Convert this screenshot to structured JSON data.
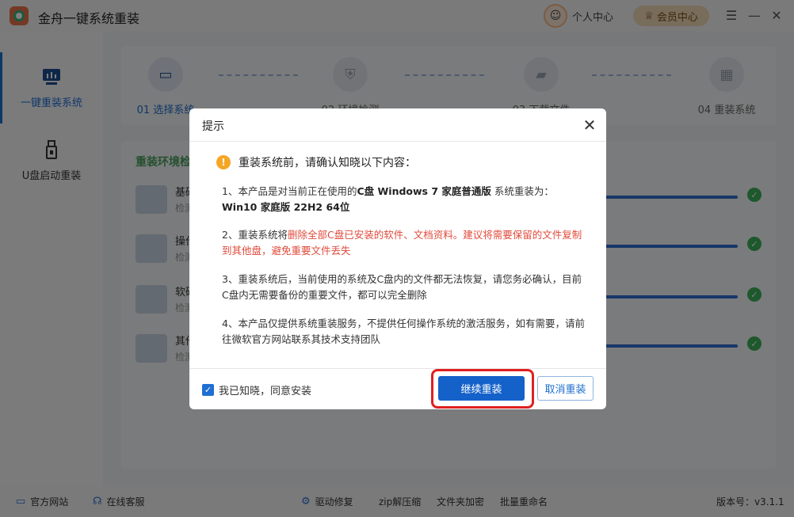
{
  "app": {
    "title": "金舟一键系统重装"
  },
  "header": {
    "user_center": "个人中心",
    "vip_center": "会员中心",
    "menu_icon": "menu-icon",
    "minimize_icon": "minimize-icon",
    "close_icon": "close-icon"
  },
  "sidebar": {
    "items": [
      {
        "label": "一键重装系统",
        "icon": "monitor-chart-icon",
        "active": true
      },
      {
        "label": "U盘启动重装",
        "icon": "usb-icon",
        "active": false
      }
    ]
  },
  "steps": [
    {
      "label": "01 选择系统",
      "icon": "monitor-icon"
    },
    {
      "label": "02 环境检测",
      "icon": "shield-icon"
    },
    {
      "label": "03 下载文件",
      "icon": "folder-icon"
    },
    {
      "label": "04 重装系统",
      "icon": "grid-icon"
    }
  ],
  "env": {
    "title": "重装环境检",
    "rows": [
      {
        "name": "基础",
        "sub": "检测"
      },
      {
        "name": "操作",
        "sub": "检测"
      },
      {
        "name": "软硬",
        "sub": "检测"
      },
      {
        "name": "其他",
        "sub": "检测"
      }
    ]
  },
  "dialog": {
    "title": "提示",
    "warning": "重装系统前，请确认知晓以下内容：",
    "p1_a": "1、本产品是对当前正在使用的",
    "p1_b": "C盘 Windows 7 家庭普通版",
    "p1_c": " 系统重装为：",
    "p1_d": "Win10 家庭版 22H2 64位",
    "p2_a": "2、重装系统将",
    "p2_b": "删除全部C盘已安装的软件、文档资料。建议将需要保留的文件复制到其他盘，避免重要文件丢失",
    "p3": "3、重装系统后，当前使用的系统及C盘内的文件都无法恢复，请您务必确认，目前C盘内无需要备份的重要文件，都可以完全删除",
    "p4": "4、本产品仅提供系统重装服务，不提供任何操作系统的激活服务，如有需要，请前往微软官方网站联系其技术支持团队",
    "agree": "我已知晓，同意安装",
    "continue": "继续重装",
    "cancel": "取消重装"
  },
  "footer": {
    "official_site": "官方网站",
    "online_service": "在线客服",
    "driver_repair": "驱动修复",
    "zip": "zip解压缩",
    "folder_encrypt": "文件夹加密",
    "batch_rename": "批量重命名",
    "version": "版本号：v3.1.1"
  },
  "colors": {
    "accent": "#1461c9",
    "success": "#3db05a",
    "warning": "#f5a623",
    "danger": "#e04a3b",
    "highlight": "#e02020"
  }
}
